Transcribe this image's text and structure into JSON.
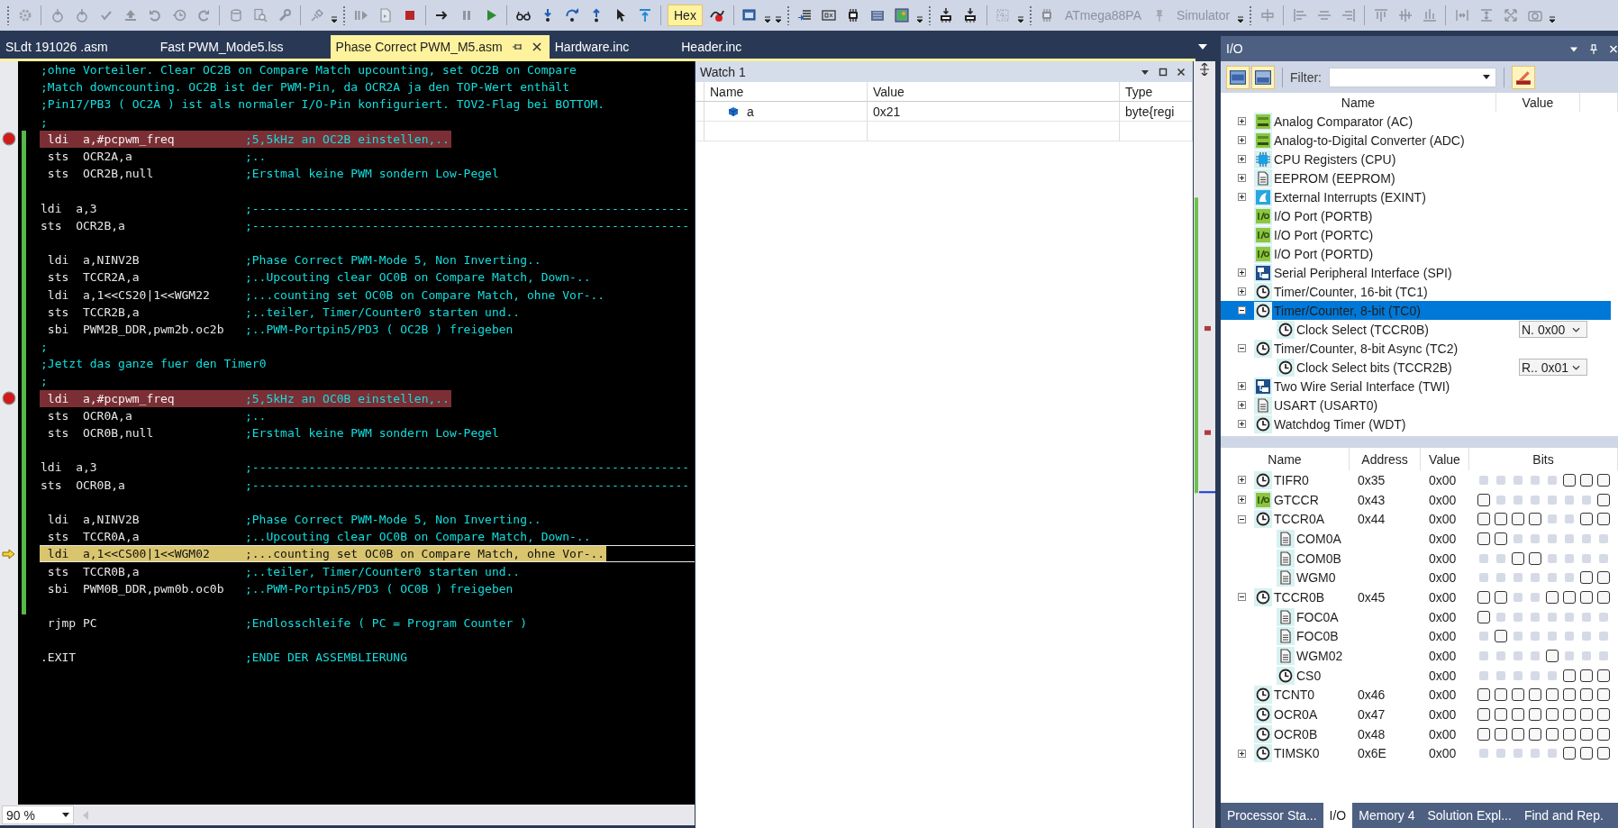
{
  "toolbar": [
    {
      "kind": "grip"
    },
    {
      "kind": "gear",
      "disabled": true
    },
    {
      "kind": "sep"
    },
    {
      "kind": "timer",
      "disabled": true
    },
    {
      "kind": "timer",
      "disabled": true
    },
    {
      "kind": "check",
      "disabled": true
    },
    {
      "kind": "upload",
      "disabled": true
    },
    {
      "kind": "undo",
      "disabled": true
    },
    {
      "kind": "history",
      "disabled": true
    },
    {
      "kind": "redo",
      "disabled": true
    },
    {
      "kind": "sep"
    },
    {
      "kind": "database",
      "disabled": true
    },
    {
      "kind": "find",
      "disabled": true
    },
    {
      "kind": "wrench",
      "disabled": true
    },
    {
      "kind": "sep"
    },
    {
      "kind": "plug",
      "disabled": true
    },
    {
      "kind": "caret"
    },
    {
      "kind": "grip"
    },
    {
      "kind": "bars",
      "disabled": true
    },
    {
      "kind": "doc",
      "disabled": true
    },
    {
      "kind": "stop",
      "disabled": false
    },
    {
      "kind": "sep"
    },
    {
      "kind": "next",
      "disabled": false
    },
    {
      "kind": "pause",
      "disabled": true
    },
    {
      "kind": "play",
      "disabled": false
    },
    {
      "kind": "sep"
    },
    {
      "kind": "glasses",
      "disabled": false
    },
    {
      "kind": "stepinto",
      "disabled": false
    },
    {
      "kind": "stepover",
      "disabled": false
    },
    {
      "kind": "stepout",
      "disabled": false
    },
    {
      "kind": "cursor",
      "disabled": false
    },
    {
      "kind": "steptop",
      "disabled": false
    },
    {
      "kind": "sep"
    },
    {
      "kind": "toggle",
      "text": "Hex",
      "selected": true
    },
    {
      "kind": "breakoff",
      "disabled": false
    },
    {
      "kind": "sep"
    },
    {
      "kind": "window",
      "disabled": false
    },
    {
      "kind": "caret"
    },
    {
      "kind": "caret"
    },
    {
      "kind": "grip"
    },
    {
      "kind": "list",
      "disabled": false
    },
    {
      "kind": "hexbox",
      "disabled": false
    },
    {
      "kind": "chip",
      "disabled": false
    },
    {
      "kind": "memory",
      "disabled": false
    },
    {
      "kind": "image",
      "disabled": false
    },
    {
      "kind": "caret"
    },
    {
      "kind": "grip"
    },
    {
      "kind": "download",
      "disabled": false
    },
    {
      "kind": "download",
      "disabled": false
    },
    {
      "kind": "sep"
    },
    {
      "kind": "grid",
      "disabled": true
    },
    {
      "kind": "caret"
    },
    {
      "kind": "grip"
    },
    {
      "kind": "chip",
      "disabled": true
    },
    {
      "kind": "device",
      "text": "ATmega88PA",
      "disabled": true
    },
    {
      "kind": "pin",
      "disabled": true
    },
    {
      "kind": "tool",
      "text": "Simulator",
      "disabled": true
    },
    {
      "kind": "caret"
    },
    {
      "kind": "grip"
    },
    {
      "kind": "alignv",
      "disabled": true
    },
    {
      "kind": "sep"
    },
    {
      "kind": "alignleft",
      "disabled": true
    },
    {
      "kind": "aligncenter",
      "disabled": true
    },
    {
      "kind": "alignright",
      "disabled": true
    },
    {
      "kind": "sep"
    },
    {
      "kind": "aligntop",
      "disabled": true
    },
    {
      "kind": "alignmiddle",
      "disabled": true
    },
    {
      "kind": "alignbottom",
      "disabled": true
    },
    {
      "kind": "sep"
    },
    {
      "kind": "hspace",
      "disabled": true
    },
    {
      "kind": "vsize",
      "disabled": true
    },
    {
      "kind": "resize",
      "disabled": true
    },
    {
      "kind": "camera",
      "disabled": true
    },
    {
      "kind": "caret"
    }
  ],
  "editor": {
    "tabs": [
      {
        "label": "SLdt 191026 .asm",
        "selected": false
      },
      {
        "label": "Fast PWM_Mode5.lss",
        "selected": false
      },
      {
        "label": "Phase Correct PWM_M5.asm",
        "selected": true
      },
      {
        "label": "Hardware.inc",
        "selected": false
      },
      {
        "label": "Header.inc",
        "selected": false
      }
    ],
    "lines": [
      {
        "kind": "comment",
        "text": ";ohne Vorteiler. Clear OC2B on Compare Match upcounting, set OC2B on Compare",
        "changed": false
      },
      {
        "kind": "comment",
        "text": ";Match downcounting. OC2B ist der PWM-Pin, da OCR2A ja den TOP-Wert enthält",
        "changed": false
      },
      {
        "kind": "comment",
        "text": ";Pin17/PB3 ( OC2A ) ist als normaler I/O-Pin konfiguriert. TOV2-Flag bei BOTTOM.",
        "changed": false
      },
      {
        "kind": "comment",
        "text": ";",
        "changed": false
      },
      {
        "kind": "code",
        "indented": true,
        "code": "ldi  a,#pcpwm_freq",
        "comment": ";5,5kHz an OC2B einstellen,..",
        "breakpoint": true,
        "current": false,
        "changed": true
      },
      {
        "kind": "code",
        "indented": true,
        "code": "sts  OCR2A,a",
        "comment": ";..",
        "breakpoint": false,
        "current": false,
        "changed": true
      },
      {
        "kind": "code",
        "indented": true,
        "code": "sts  OCR2B,null",
        "comment": ";Erstmal keine PWM sondern Low-Pegel",
        "breakpoint": false,
        "current": false,
        "changed": true
      },
      {
        "kind": "blank",
        "changed": true
      },
      {
        "kind": "code",
        "indented": false,
        "code": "ldi  a,3",
        "comment": ";--------------------------------------------------------------",
        "breakpoint": false,
        "current": false,
        "changed": true
      },
      {
        "kind": "code",
        "indented": false,
        "code": "sts  OCR2B,a",
        "comment": ";--------------------------------------------------------------",
        "breakpoint": false,
        "current": false,
        "changed": true
      },
      {
        "kind": "blank",
        "changed": true
      },
      {
        "kind": "code",
        "indented": true,
        "code": "ldi  a,NINV2B",
        "comment": ";Phase Correct PWM-Mode 5, Non Inverting..",
        "breakpoint": false,
        "current": false,
        "changed": true
      },
      {
        "kind": "code",
        "indented": true,
        "code": "sts  TCCR2A,a",
        "comment": ";..Upcouting clear OC0B on Compare Match, Down-..",
        "breakpoint": false,
        "current": false,
        "changed": true
      },
      {
        "kind": "code",
        "indented": true,
        "code": "ldi  a,1<<CS20|1<<WGM22",
        "comment": ";...counting set OC0B on Compare Match, ohne Vor-..",
        "breakpoint": false,
        "current": false,
        "changed": true
      },
      {
        "kind": "code",
        "indented": true,
        "code": "sts  TCCR2B,a",
        "comment": ";..teiler, Timer/Counter0 starten und..",
        "breakpoint": false,
        "current": false,
        "changed": true
      },
      {
        "kind": "code",
        "indented": true,
        "code": "sbi  PWM2B_DDR,pwm2b.oc2b",
        "comment": ";..PWM-Portpin5/PD3 ( OC2B ) freigeben",
        "breakpoint": false,
        "current": false,
        "changed": true
      },
      {
        "kind": "comment",
        "text": ";",
        "changed": true
      },
      {
        "kind": "comment",
        "text": ";Jetzt das ganze fuer den Timer0",
        "changed": true
      },
      {
        "kind": "comment",
        "text": ";",
        "changed": true
      },
      {
        "kind": "code",
        "indented": true,
        "code": "ldi  a,#pcpwm_freq",
        "comment": ";5,5kHz an OC0B einstellen,..",
        "breakpoint": true,
        "current": false,
        "changed": true
      },
      {
        "kind": "code",
        "indented": true,
        "code": "sts  OCR0A,a",
        "comment": ";..",
        "breakpoint": false,
        "current": false,
        "changed": true
      },
      {
        "kind": "code",
        "indented": true,
        "code": "sts  OCR0B,null",
        "comment": ";Erstmal keine PWM sondern Low-Pegel",
        "breakpoint": false,
        "current": false,
        "changed": true
      },
      {
        "kind": "blank",
        "changed": true
      },
      {
        "kind": "code",
        "indented": false,
        "code": "ldi  a,3",
        "comment": ";--------------------------------------------------------------",
        "breakpoint": false,
        "current": false,
        "changed": true
      },
      {
        "kind": "code",
        "indented": false,
        "code": "sts  OCR0B,a",
        "comment": ";--------------------------------------------------------------",
        "breakpoint": false,
        "current": false,
        "changed": true
      },
      {
        "kind": "blank",
        "changed": true
      },
      {
        "kind": "code",
        "indented": true,
        "code": "ldi  a,NINV2B",
        "comment": ";Phase Correct PWM-Mode 5, Non Inverting..",
        "breakpoint": false,
        "current": false,
        "changed": true
      },
      {
        "kind": "code",
        "indented": true,
        "code": "sts  TCCR0A,a",
        "comment": ";..Upcouting clear OC0B on Compare Match, Down-..",
        "breakpoint": false,
        "current": false,
        "changed": true
      },
      {
        "kind": "code",
        "indented": true,
        "code": "ldi  a,1<<CS00|1<<WGM02",
        "comment": ";...counting set OC0B on Compare Match, ohne Vor-..",
        "breakpoint": false,
        "current": true,
        "changed": true
      },
      {
        "kind": "code",
        "indented": true,
        "code": "sts  TCCR0B,a",
        "comment": ";..teiler, Timer/Counter0 starten und..",
        "breakpoint": false,
        "current": false,
        "changed": true
      },
      {
        "kind": "code",
        "indented": true,
        "code": "sbi  PWM0B_DDR,pwm0b.oc0b",
        "comment": ";..PWM-Portpin5/PD3 ( OC0B ) freigeben",
        "breakpoint": false,
        "current": false,
        "changed": true
      },
      {
        "kind": "blank",
        "changed": true
      },
      {
        "kind": "code",
        "indented": true,
        "code": "rjmp PC",
        "comment": ";Endlosschleife ( PC = Program Counter )",
        "breakpoint": false,
        "current": false,
        "changed": false
      },
      {
        "kind": "blank",
        "changed": false
      },
      {
        "kind": "code",
        "indented": false,
        "code": ".EXIT",
        "comment": ";ENDE DER ASSEMBLIERUNG",
        "breakpoint": false,
        "current": false,
        "changed": false
      }
    ],
    "zoom": "90 %"
  },
  "watch": {
    "title": "Watch 1",
    "columns": [
      "Name",
      "Value",
      "Type"
    ],
    "rows": [
      {
        "name": "a",
        "value": "0x21",
        "type": "byte{regi"
      }
    ]
  },
  "io": {
    "title": "I/O",
    "filter_label": "Filter:",
    "tree_columns": [
      "Name",
      "Value"
    ],
    "tree": [
      {
        "label": "Analog Comparator (AC)",
        "kind": "adc",
        "expandable": true,
        "expanded": false,
        "selected": false
      },
      {
        "label": "Analog-to-Digital Converter (ADC)",
        "kind": "adc",
        "expandable": true,
        "expanded": false,
        "selected": false
      },
      {
        "label": "CPU Registers (CPU)",
        "kind": "cpu",
        "expandable": true,
        "expanded": false,
        "selected": false
      },
      {
        "label": "EEPROM (EEPROM)",
        "kind": "doc",
        "expandable": true,
        "expanded": false,
        "selected": false
      },
      {
        "label": "External Interrupts (EXINT)",
        "kind": "interrupt",
        "expandable": true,
        "expanded": false,
        "selected": false
      },
      {
        "label": "I/O Port (PORTB)",
        "kind": "io",
        "expandable": false,
        "selected": false
      },
      {
        "label": "I/O Port (PORTC)",
        "kind": "io",
        "expandable": false,
        "selected": false
      },
      {
        "label": "I/O Port (PORTD)",
        "kind": "io",
        "expandable": false,
        "selected": false
      },
      {
        "label": "Serial Peripheral Interface (SPI)",
        "kind": "bus",
        "expandable": true,
        "expanded": false,
        "selected": false
      },
      {
        "label": "Timer/Counter, 16-bit (TC1)",
        "kind": "clock",
        "expandable": true,
        "expanded": false,
        "selected": false
      },
      {
        "label": "Timer/Counter, 8-bit (TC0)",
        "kind": "clock",
        "expandable": true,
        "expanded": true,
        "selected": true,
        "children": [
          {
            "label": "Clock Select (TCCR0B)",
            "kind": "clock",
            "value": "N. 0x00",
            "selected": false
          }
        ]
      },
      {
        "label": "Timer/Counter, 8-bit Async (TC2)",
        "kind": "clock",
        "expandable": true,
        "expanded": true,
        "selected": false,
        "children": [
          {
            "label": "Clock Select bits (TCCR2B)",
            "kind": "clock",
            "value": "R.. 0x01",
            "selected": false
          }
        ]
      },
      {
        "label": "Two Wire Serial Interface (TWI)",
        "kind": "bus",
        "expandable": true,
        "expanded": false,
        "selected": false
      },
      {
        "label": "USART (USART0)",
        "kind": "doc",
        "expandable": true,
        "expanded": false,
        "selected": false
      },
      {
        "label": "Watchdog Timer (WDT)",
        "kind": "clock",
        "expandable": true,
        "expanded": false,
        "selected": false
      }
    ],
    "register_columns": [
      "Name",
      "Address",
      "Value",
      "Bits"
    ],
    "registers": [
      {
        "name": "TIFR0",
        "kind": "clock",
        "expandable": true,
        "expanded": false,
        "address": "0x35",
        "value": "0x00",
        "bits": [
          {
            "available": false
          },
          {
            "available": false
          },
          {
            "available": false
          },
          {
            "available": false
          },
          {
            "available": false
          },
          {
            "available": true,
            "checked": false
          },
          {
            "available": true,
            "checked": false
          },
          {
            "available": true,
            "checked": false
          }
        ]
      },
      {
        "name": "GTCCR",
        "kind": "io",
        "expandable": true,
        "expanded": false,
        "address": "0x43",
        "value": "0x00",
        "bits": [
          {
            "available": true,
            "checked": false
          },
          {
            "available": false
          },
          {
            "available": false
          },
          {
            "available": false
          },
          {
            "available": false
          },
          {
            "available": false
          },
          {
            "available": false
          },
          {
            "available": true,
            "checked": false
          }
        ]
      },
      {
        "name": "TCCR0A",
        "kind": "clock",
        "expandable": true,
        "expanded": true,
        "address": "0x44",
        "value": "0x00",
        "bits": [
          {
            "available": true,
            "checked": false
          },
          {
            "available": true,
            "checked": false
          },
          {
            "available": true,
            "checked": false
          },
          {
            "available": true,
            "checked": false
          },
          {
            "available": false
          },
          {
            "available": false
          },
          {
            "available": true,
            "checked": false
          },
          {
            "available": true,
            "checked": false
          }
        ],
        "children": [
          {
            "name": "COM0A",
            "kind": "doc",
            "value": "0x00",
            "bits": [
              {
                "available": true,
                "checked": false
              },
              {
                "available": true,
                "checked": false
              },
              {
                "available": false
              },
              {
                "available": false
              },
              {
                "available": false
              },
              {
                "available": false
              },
              {
                "available": false
              },
              {
                "available": false
              }
            ]
          },
          {
            "name": "COM0B",
            "kind": "doc",
            "value": "0x00",
            "bits": [
              {
                "available": false
              },
              {
                "available": false
              },
              {
                "available": true,
                "checked": false
              },
              {
                "available": true,
                "checked": false
              },
              {
                "available": false
              },
              {
                "available": false
              },
              {
                "available": false
              },
              {
                "available": false
              }
            ]
          },
          {
            "name": "WGM0",
            "kind": "doc",
            "value": "0x00",
            "bits": [
              {
                "available": false
              },
              {
                "available": false
              },
              {
                "available": false
              },
              {
                "available": false
              },
              {
                "available": false
              },
              {
                "available": false
              },
              {
                "available": true,
                "checked": false
              },
              {
                "available": true,
                "checked": false
              }
            ]
          }
        ]
      },
      {
        "name": "TCCR0B",
        "kind": "clock",
        "expandable": true,
        "expanded": true,
        "address": "0x45",
        "value": "0x00",
        "bits": [
          {
            "available": true,
            "checked": false
          },
          {
            "available": true,
            "checked": false
          },
          {
            "available": false
          },
          {
            "available": false
          },
          {
            "available": true,
            "checked": false
          },
          {
            "available": true,
            "checked": false
          },
          {
            "available": true,
            "checked": false
          },
          {
            "available": true,
            "checked": false
          }
        ],
        "children": [
          {
            "name": "FOC0A",
            "kind": "doc",
            "value": "0x00",
            "bits": [
              {
                "available": true,
                "checked": false
              },
              {
                "available": false
              },
              {
                "available": false
              },
              {
                "available": false
              },
              {
                "available": false
              },
              {
                "available": false
              },
              {
                "available": false
              },
              {
                "available": false
              }
            ]
          },
          {
            "name": "FOC0B",
            "kind": "doc",
            "value": "0x00",
            "bits": [
              {
                "available": false
              },
              {
                "available": true,
                "checked": false
              },
              {
                "available": false
              },
              {
                "available": false
              },
              {
                "available": false
              },
              {
                "available": false
              },
              {
                "available": false
              },
              {
                "available": false
              }
            ]
          },
          {
            "name": "WGM02",
            "kind": "doc",
            "value": "0x00",
            "bits": [
              {
                "available": false
              },
              {
                "available": false
              },
              {
                "available": false
              },
              {
                "available": false
              },
              {
                "available": true,
                "checked": false
              },
              {
                "available": false
              },
              {
                "available": false
              },
              {
                "available": false
              }
            ]
          },
          {
            "name": "CS0",
            "kind": "clock",
            "value": "0x00",
            "bits": [
              {
                "available": false
              },
              {
                "available": false
              },
              {
                "available": false
              },
              {
                "available": false
              },
              {
                "available": false
              },
              {
                "available": true,
                "checked": false
              },
              {
                "available": true,
                "checked": false
              },
              {
                "available": true,
                "checked": false
              }
            ]
          }
        ]
      },
      {
        "name": "TCNT0",
        "kind": "clock",
        "expandable": false,
        "address": "0x46",
        "value": "0x00",
        "bits": [
          {
            "available": true,
            "checked": false
          },
          {
            "available": true,
            "checked": false
          },
          {
            "available": true,
            "checked": false
          },
          {
            "available": true,
            "checked": false
          },
          {
            "available": true,
            "checked": false
          },
          {
            "available": true,
            "checked": false
          },
          {
            "available": true,
            "checked": false
          },
          {
            "available": true,
            "checked": false
          }
        ]
      },
      {
        "name": "OCR0A",
        "kind": "clock",
        "expandable": false,
        "address": "0x47",
        "value": "0x00",
        "bits": [
          {
            "available": true,
            "checked": false
          },
          {
            "available": true,
            "checked": false
          },
          {
            "available": true,
            "checked": false
          },
          {
            "available": true,
            "checked": false
          },
          {
            "available": true,
            "checked": false
          },
          {
            "available": true,
            "checked": false
          },
          {
            "available": true,
            "checked": false
          },
          {
            "available": true,
            "checked": false
          }
        ]
      },
      {
        "name": "OCR0B",
        "kind": "clock",
        "expandable": false,
        "address": "0x48",
        "value": "0x00",
        "bits": [
          {
            "available": true,
            "checked": false
          },
          {
            "available": true,
            "checked": false
          },
          {
            "available": true,
            "checked": false
          },
          {
            "available": true,
            "checked": false
          },
          {
            "available": true,
            "checked": false
          },
          {
            "available": true,
            "checked": false
          },
          {
            "available": true,
            "checked": false
          },
          {
            "available": true,
            "checked": false
          }
        ]
      },
      {
        "name": "TIMSK0",
        "kind": "clock",
        "expandable": true,
        "expanded": false,
        "address": "0x6E",
        "value": "0x00",
        "bits": [
          {
            "available": false
          },
          {
            "available": false
          },
          {
            "available": false
          },
          {
            "available": false
          },
          {
            "available": false
          },
          {
            "available": true,
            "checked": false
          },
          {
            "available": true,
            "checked": false
          },
          {
            "available": true,
            "checked": false
          }
        ]
      }
    ]
  },
  "bottom_tabs": [
    {
      "label": "Processor Sta...",
      "selected": false
    },
    {
      "label": "I/O",
      "selected": true
    },
    {
      "label": "Memory 4",
      "selected": false
    },
    {
      "label": "Solution Expl...",
      "selected": false
    },
    {
      "label": "Find and Rep.",
      "selected": false
    }
  ]
}
